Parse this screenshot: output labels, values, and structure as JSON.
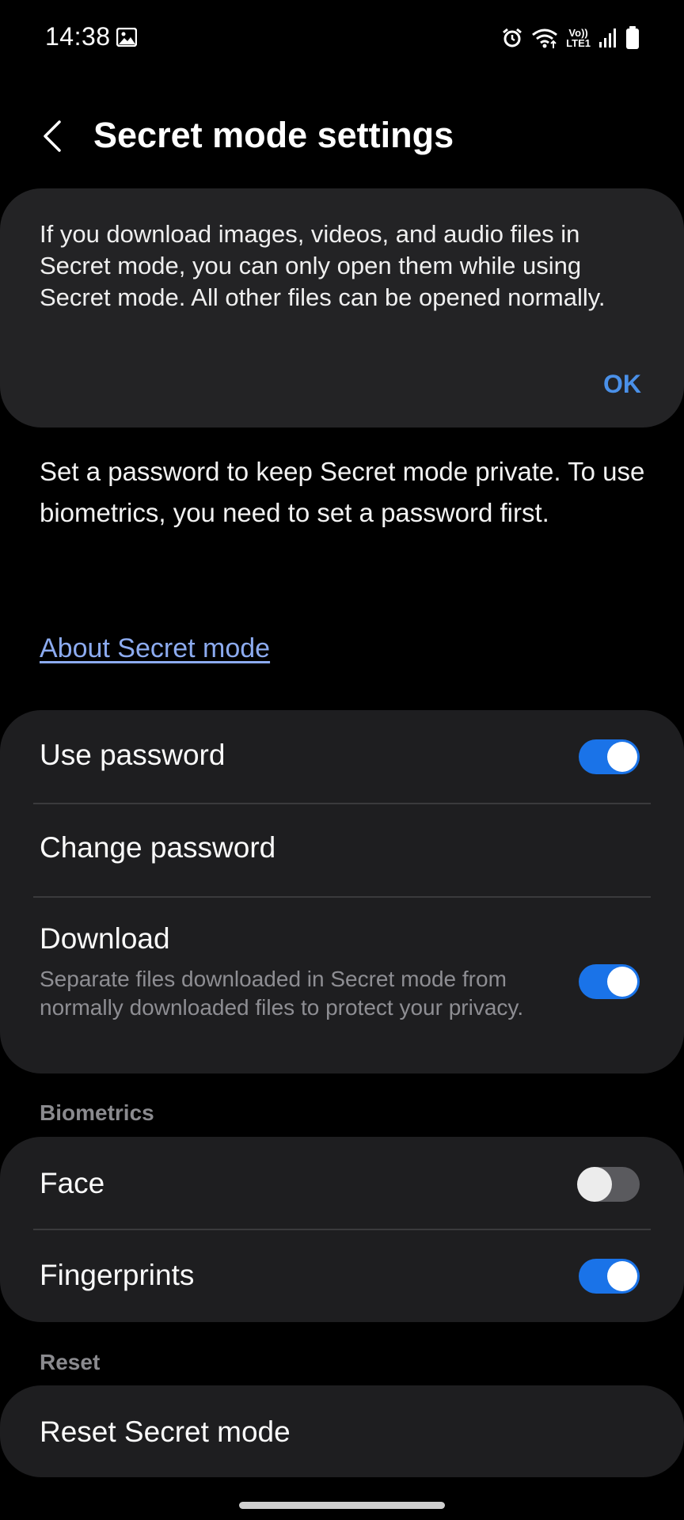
{
  "status_bar": {
    "time": "14:38",
    "volte_top": "Vo))",
    "volte_bottom": "LTE1"
  },
  "header": {
    "title": "Secret mode settings"
  },
  "notice": {
    "text": "If you download images, videos, and audio files in Secret mode, you can only open them while using Secret mode. All other files can be opened normally.",
    "ok_label": "OK"
  },
  "intro": {
    "text": "Set a password to keep Secret mode private. To use biometrics, you need to set a password first.",
    "link": "About Secret mode"
  },
  "password_group": {
    "use_password": {
      "label": "Use password",
      "enabled": true
    },
    "change_password": {
      "label": "Change password"
    },
    "download": {
      "label": "Download",
      "description": "Separate files downloaded in Secret mode from normally downloaded files to protect your privacy.",
      "enabled": true
    }
  },
  "biometrics": {
    "header": "Biometrics",
    "face": {
      "label": "Face",
      "enabled": false
    },
    "fingerprints": {
      "label": "Fingerprints",
      "enabled": true
    }
  },
  "reset": {
    "header": "Reset",
    "reset_secret_mode": {
      "label": "Reset Secret mode"
    }
  },
  "colors": {
    "accent": "#1a73e8",
    "link": "#8cabf0",
    "ok": "#4a90e8"
  }
}
